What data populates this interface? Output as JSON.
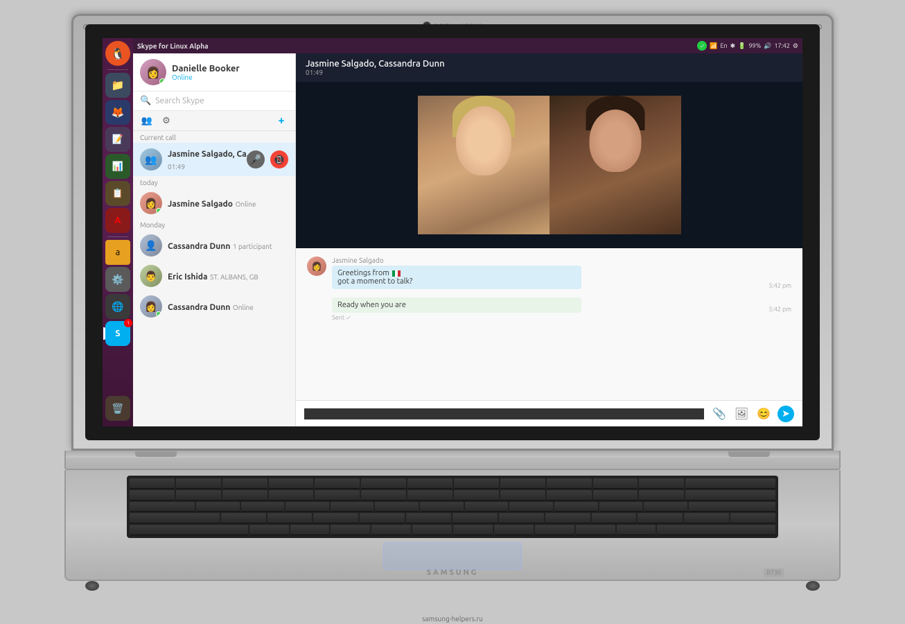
{
  "laptop": {
    "brand": "SAMSUNG",
    "model": "R730",
    "website": "samsung-helpers.ru"
  },
  "system_bar": {
    "app_title": "Skype for Linux Alpha",
    "tray": {
      "time": "17:42",
      "battery": "99%",
      "wifi": "En"
    }
  },
  "sidebar": {
    "profile": {
      "name": "Danielle Booker",
      "status": "Online"
    },
    "search_placeholder": "Search Skype",
    "sections": [
      {
        "label": "Current call",
        "items": [
          {
            "name": "Jasmine Salgado, Ca...",
            "sub": "01:49",
            "type": "group_call",
            "active": true
          }
        ]
      },
      {
        "label": "today",
        "items": [
          {
            "name": "Jasmine Salgado",
            "sub": "Online",
            "type": "contact",
            "online": true
          }
        ]
      },
      {
        "label": "Monday",
        "items": [
          {
            "name": "Cassandra Dunn",
            "sub": "1 participant",
            "type": "group"
          },
          {
            "name": "Eric Ishida",
            "sub": "ST. ALBANS, GB",
            "type": "contact"
          },
          {
            "name": "Cassandra Dunn",
            "sub": "Online",
            "type": "contact",
            "online": true
          }
        ]
      }
    ]
  },
  "main": {
    "call": {
      "title": "Jasmine Salgado, Cassandra Dunn",
      "timer": "01:49"
    },
    "messages": [
      {
        "sender": "Jasmine Salgado",
        "lines": [
          "Greetings from 🇮🇹",
          "got a moment to talk?"
        ],
        "time": "5:42 pm",
        "sent_by_me": false
      },
      {
        "sender": "",
        "lines": [
          "Ready when you are"
        ],
        "time": "5:42 pm",
        "sent_by_me": true,
        "status": "Sent"
      }
    ],
    "input": {
      "placeholder": ""
    }
  },
  "ubuntu_icons": [
    {
      "name": "ubuntu-logo",
      "symbol": "🐧"
    },
    {
      "name": "files-icon",
      "symbol": "📁"
    },
    {
      "name": "firefox-icon",
      "symbol": "🦊"
    },
    {
      "name": "text-editor-icon",
      "symbol": "📄"
    },
    {
      "name": "spreadsheet-icon",
      "symbol": "📊"
    },
    {
      "name": "documents-icon",
      "symbol": "📋"
    },
    {
      "name": "unknown-icon",
      "symbol": "⬛"
    },
    {
      "name": "amazon-icon",
      "symbol": "📦"
    },
    {
      "name": "settings-icon",
      "symbol": "⚙️"
    },
    {
      "name": "chrome-icon",
      "symbol": "🌐"
    },
    {
      "name": "skype-icon",
      "symbol": "💬"
    }
  ]
}
